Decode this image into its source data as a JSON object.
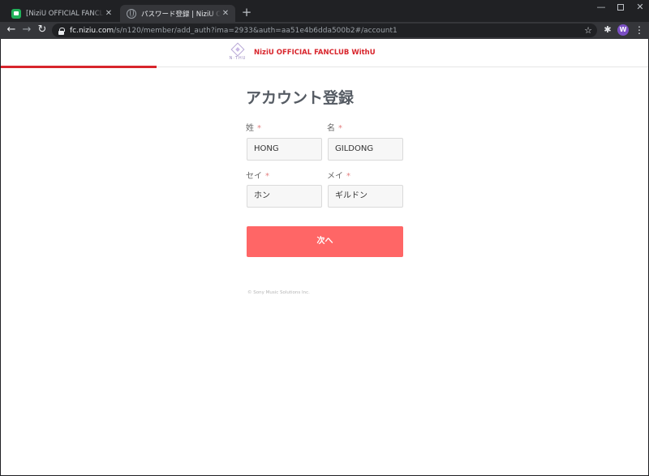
{
  "browser": {
    "tabs": [
      {
        "title": "[NiziU OFFICIAL FANCLUB WithU",
        "active": false,
        "favicon": "green-app-icon"
      },
      {
        "title": "パスワード登録 | NiziU OFFICIAL FA",
        "active": true,
        "favicon": "globe-icon"
      }
    ],
    "close_glyph": "✕",
    "new_tab_glyph": "+",
    "url_host": "fc.niziu.com",
    "url_path": "/s/n120/member/add_auth?ima=2933&auth=aa51e4b6dda500b2#/account1",
    "profile_initial": "W",
    "colors": {
      "tabstrip": "#202124",
      "toolbar": "#35363a",
      "profile": "#7b4fc4"
    }
  },
  "site": {
    "name": "NiziU OFFICIAL FANCLUB WithU",
    "logo_text": "N·THU",
    "accent": "#d8252c",
    "progress_fraction": 0.24
  },
  "form": {
    "title": "アカウント登録",
    "required_mark": "*",
    "last_name": {
      "label": "姓",
      "value": "HONG"
    },
    "first_name": {
      "label": "名",
      "value": "GILDONG"
    },
    "last_name_kana": {
      "label": "セイ",
      "value": "ホン"
    },
    "first_name_kana": {
      "label": "メイ",
      "value": "ギルドン"
    },
    "next_button": "次へ",
    "button_color": "#ff6666"
  },
  "footer": {
    "copyright": "© Sony Music Solutions Inc."
  }
}
